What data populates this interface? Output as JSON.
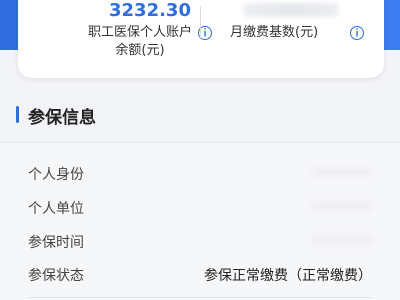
{
  "summary": {
    "account_amount": "3232.30",
    "account_label_line1": "职工医保个人账户",
    "account_label_line2": "余额(元)",
    "base_label": "月缴费基数(元)"
  },
  "section": {
    "title": "参保信息"
  },
  "rows": [
    {
      "label": "个人身份",
      "value": ""
    },
    {
      "label": "个人单位",
      "value": ""
    },
    {
      "label": "参保时间",
      "value": ""
    },
    {
      "label": "参保状态",
      "value": "参保正常缴费（正常缴费）"
    }
  ],
  "colors": {
    "accent": "#2f6de0",
    "header_blue": "#3d7bf0"
  },
  "icons": {
    "info": "info-circle-icon"
  }
}
